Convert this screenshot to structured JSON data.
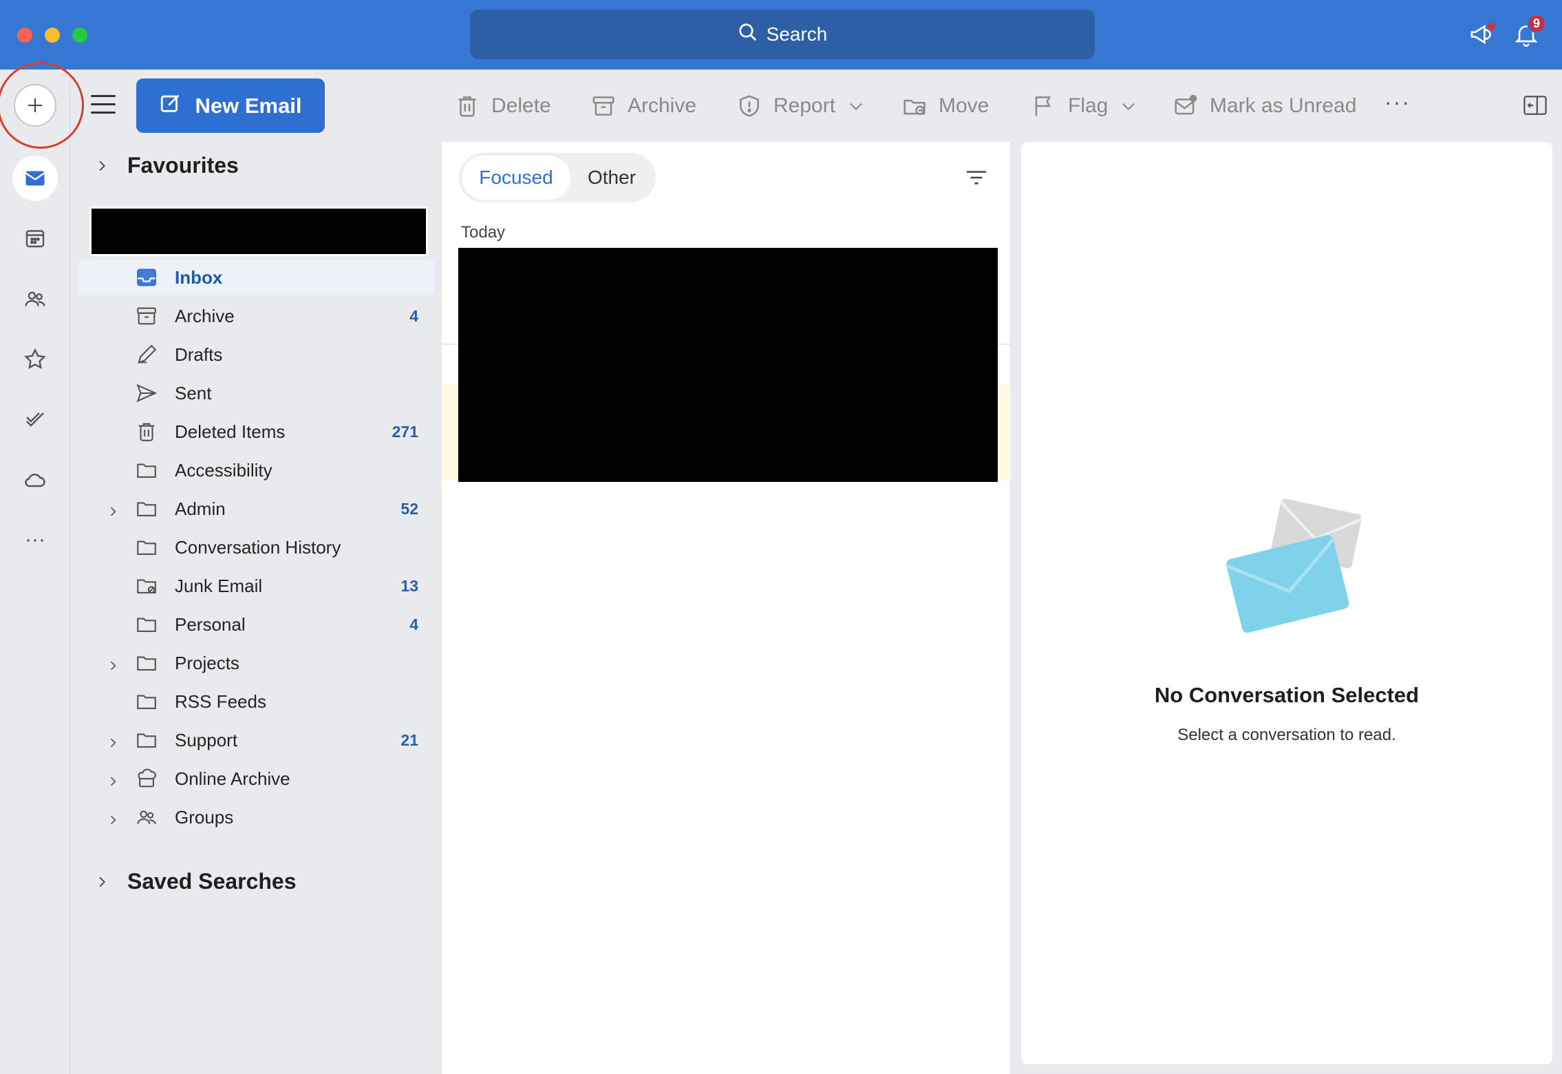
{
  "titlebar": {
    "search_label": "Search",
    "notification_count": "9"
  },
  "toolbar": {
    "new_email_label": "New Email",
    "delete_label": "Delete",
    "archive_label": "Archive",
    "report_label": "Report",
    "move_label": "Move",
    "flag_label": "Flag",
    "mark_unread_label": "Mark as Unread",
    "more_label": "···"
  },
  "folders": {
    "favourites_label": "Favourites",
    "saved_searches_label": "Saved Searches",
    "items": [
      {
        "name": "Inbox",
        "count": ""
      },
      {
        "name": "Archive",
        "count": "4"
      },
      {
        "name": "Drafts",
        "count": ""
      },
      {
        "name": "Sent",
        "count": ""
      },
      {
        "name": "Deleted Items",
        "count": "271"
      },
      {
        "name": "Accessibility",
        "count": ""
      },
      {
        "name": "Admin",
        "count": "52"
      },
      {
        "name": "Conversation History",
        "count": ""
      },
      {
        "name": "Junk Email",
        "count": "13"
      },
      {
        "name": "Personal",
        "count": "4"
      },
      {
        "name": "Projects",
        "count": ""
      },
      {
        "name": "RSS Feeds",
        "count": ""
      },
      {
        "name": "Support",
        "count": "21"
      },
      {
        "name": "Online Archive",
        "count": ""
      },
      {
        "name": "Groups",
        "count": ""
      }
    ]
  },
  "message_list": {
    "tab_focused": "Focused",
    "tab_other": "Other",
    "group_today": "Today"
  },
  "reading_pane": {
    "title": "No Conversation Selected",
    "subtitle": "Select a conversation to read."
  },
  "colors": {
    "accent": "#2f6fd1",
    "titlebar": "#3478d4",
    "badge": "#c4314b"
  }
}
